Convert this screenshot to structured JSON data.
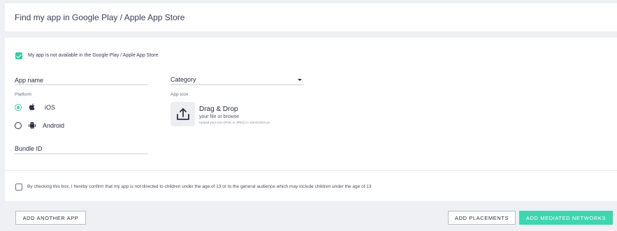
{
  "header": {
    "title": "Find my app in Google Play / Apple App Store"
  },
  "form": {
    "not_available_checkbox_label": "My app is not available in the Google Play / Apple App Store",
    "app_name_label": "App name",
    "category_label": "Category",
    "platform_label": "Platform",
    "platform_options": [
      "iOS",
      "Android"
    ],
    "selected_platform": "iOS",
    "app_icon_label": "App icon",
    "drag_drop": {
      "title": "Drag & Drop",
      "subtitle": "your file or browse",
      "hint": "Upload your icon (PNG or JPEG) in 1024X1024 px"
    },
    "bundle_id_label": "Bundle ID",
    "consent_text": "By checking this box, I hereby confirm that my app is not directed to children under the age of 13 or to the general audience which may include children under the age of 13"
  },
  "actions": {
    "add_another_app": "ADD ANOTHER APP",
    "add_placements": "ADD PLACEMENTS",
    "add_mediated_networks": "ADD MEDIATED NETWORKS"
  },
  "icons": [
    "check-icon",
    "chevron-down-icon",
    "apple-icon",
    "android-icon",
    "upload-icon"
  ],
  "colors": {
    "accent": "#3cc9a3",
    "primary_button": "#3ed6ae",
    "text": "#2c2f45",
    "background": "#eef0f4"
  }
}
